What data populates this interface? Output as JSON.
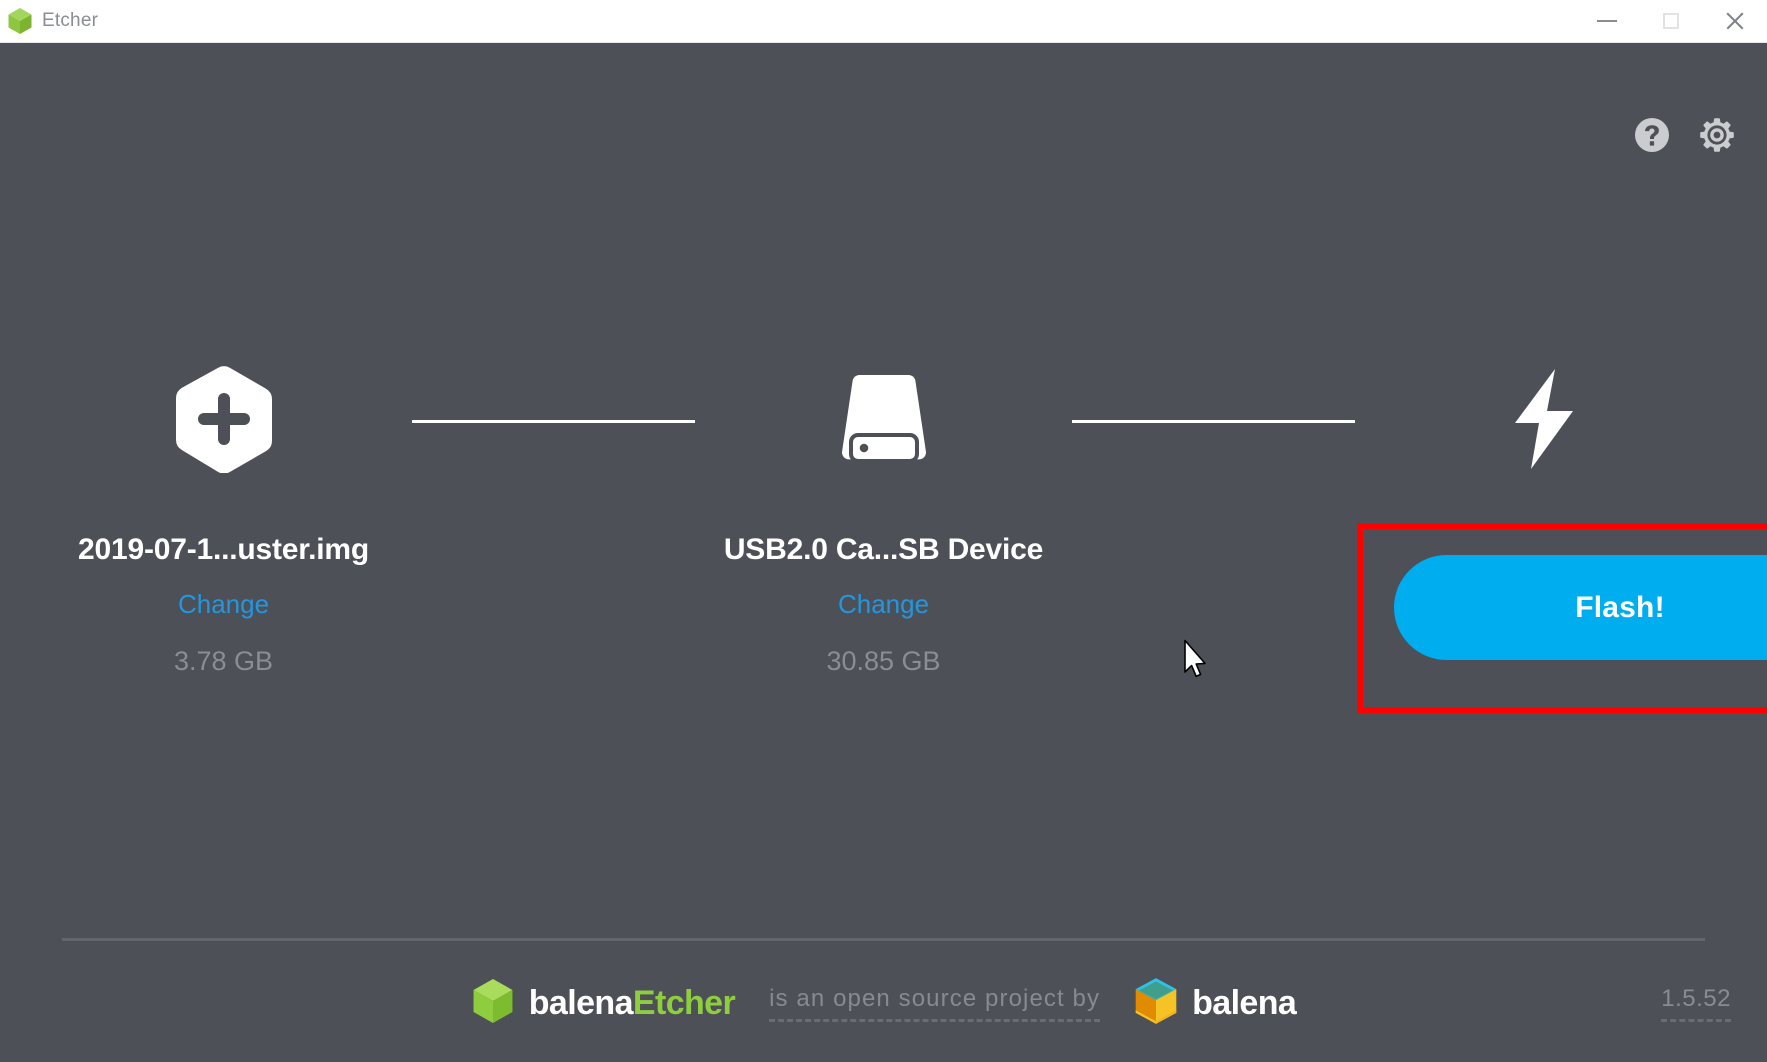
{
  "window": {
    "title": "Etcher",
    "app_icon": "etcher-cube-icon",
    "background_color": "#4d5057",
    "controls": {
      "minimize": "minimize-icon",
      "maximize": "maximize-icon",
      "close": "close-icon"
    }
  },
  "top_actions": [
    {
      "name": "help-icon",
      "label": "?"
    },
    {
      "name": "gear-icon",
      "label": ""
    }
  ],
  "steps": {
    "image": {
      "icon": "add-hexagon-icon",
      "title": "2019-07-1...uster.img",
      "change_label": "Change",
      "size": "3.78 GB"
    },
    "drive": {
      "icon": "hard-drive-icon",
      "title": "USB2.0 Ca...SB Device",
      "change_label": "Change",
      "size": "30.85 GB"
    },
    "flash": {
      "icon": "lightning-bolt-icon",
      "button_label": "Flash!",
      "button_color": "#00adee",
      "highlight_color": "#ff0000"
    }
  },
  "footer": {
    "etcher_brand_first": "balena",
    "etcher_brand_second": "Etcher",
    "open_source_text": "is an open source project by",
    "balena_brand": "balena",
    "version": "1.5.52",
    "accent_green": "#8ece3e"
  }
}
